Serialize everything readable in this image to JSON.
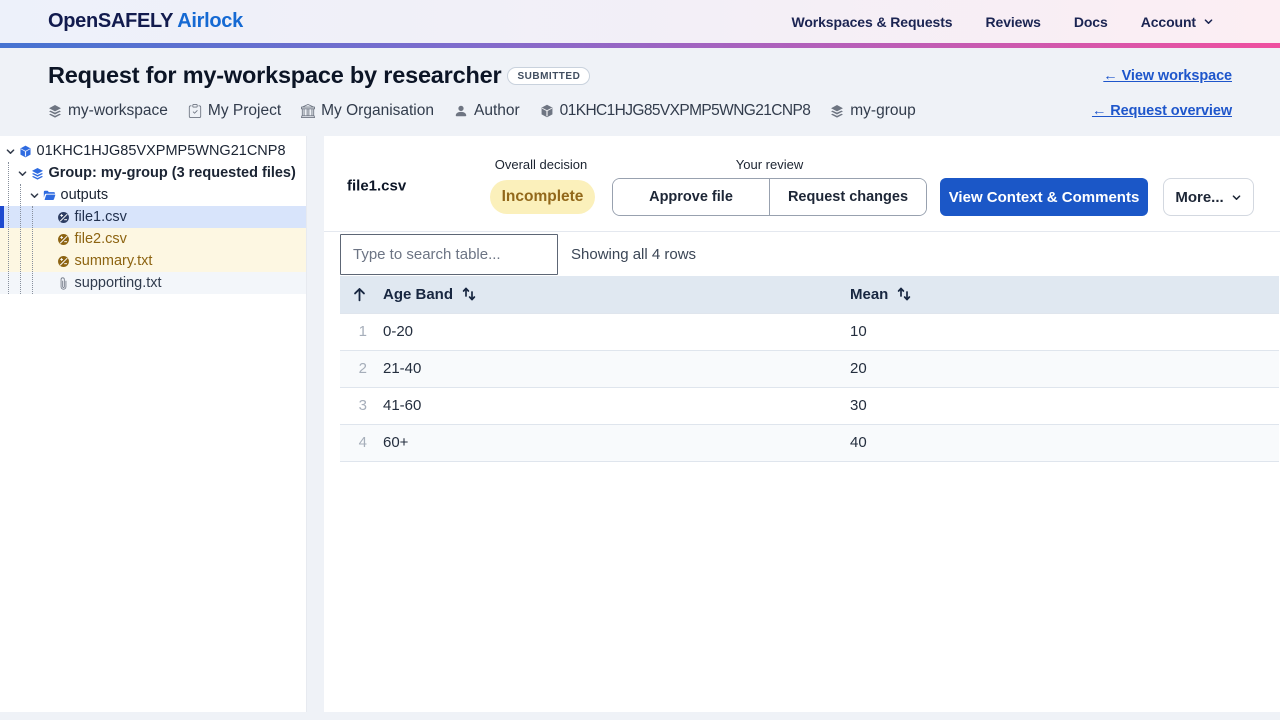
{
  "nav": {
    "brand": {
      "primary": "OpenSAFELY",
      "secondary": "Airlock"
    },
    "links": [
      {
        "label": "Workspaces & Requests",
        "dropdown": false
      },
      {
        "label": "Reviews",
        "dropdown": false
      },
      {
        "label": "Docs",
        "dropdown": false
      },
      {
        "label": "Account",
        "dropdown": true
      }
    ]
  },
  "header": {
    "title": "Request for my-workspace by researcher",
    "status_badge": "SUBMITTED",
    "view_workspace_link": "← View workspace",
    "request_overview_link": "← Request overview",
    "meta": [
      {
        "icon": "layers-icon",
        "label": "my-workspace"
      },
      {
        "icon": "clipboard-icon",
        "label": "My Project"
      },
      {
        "icon": "bank-icon",
        "label": "My Organisation"
      },
      {
        "icon": "person-icon",
        "label": "Author"
      },
      {
        "icon": "cube-icon",
        "label": "01KHC1HJG85VXPMP5WNG21CNP8"
      },
      {
        "icon": "layers-icon",
        "label": "my-group"
      }
    ]
  },
  "sidebar": {
    "tree": [
      {
        "label": "01KHC1HJG85VXPMP5WNG21CNP8",
        "icon": "cube-icon",
        "icon_color": "#2f6be0",
        "level": 0,
        "expanded": true,
        "bold": false,
        "state": "default"
      },
      {
        "label": "Group: my-group (3 requested files)",
        "icon": "layers-icon",
        "icon_color": "#2f6be0",
        "level": 1,
        "expanded": true,
        "bold": true,
        "state": "default"
      },
      {
        "label": "outputs",
        "icon": "folder-icon",
        "icon_color": "#2f6be0",
        "level": 2,
        "expanded": true,
        "bold": false,
        "state": "default"
      },
      {
        "label": "file1.csv",
        "icon": "file-diff-icon",
        "icon_color": "#2d3d63",
        "level": 3,
        "expanded": null,
        "bold": false,
        "state": "selected"
      },
      {
        "label": "file2.csv",
        "icon": "file-diff-icon",
        "icon_color": "#8d6412",
        "level": 3,
        "expanded": null,
        "bold": false,
        "state": "attention"
      },
      {
        "label": "summary.txt",
        "icon": "file-diff-icon",
        "icon_color": "#8d6412",
        "level": 3,
        "expanded": null,
        "bold": false,
        "state": "attention"
      },
      {
        "label": "supporting.txt",
        "icon": "paperclip-icon",
        "icon_color": "#6b7280",
        "level": 3,
        "expanded": null,
        "bold": false,
        "state": "supporting"
      }
    ]
  },
  "content": {
    "file_title": "file1.csv",
    "overall_decision_label": "Overall decision",
    "decision_badge": "Incomplete",
    "your_review_label": "Your review",
    "approve_button": "Approve file",
    "request_changes_button": "Request changes",
    "context_button": "View Context & Comments",
    "more_button": "More...",
    "search_placeholder": "Type to search table...",
    "rows_status": "Showing all 4 rows"
  },
  "table": {
    "columns": [
      {
        "label": "Age Band",
        "sortable": true
      },
      {
        "label": "Mean",
        "sortable": true
      }
    ],
    "rows": [
      {
        "num": "1",
        "age_band": "0-20",
        "mean": "10"
      },
      {
        "num": "2",
        "age_band": "21-40",
        "mean": "20"
      },
      {
        "num": "3",
        "age_band": "41-60",
        "mean": "30"
      },
      {
        "num": "4",
        "age_band": "60+",
        "mean": "40"
      }
    ]
  },
  "colors": {
    "accent_blue": "#1b57c7",
    "selected_row_bg": "#d8e4fb",
    "selected_row_bar": "#1d49cf",
    "attention_row_bg": "#fdf7e2",
    "attention_text": "#8d6412",
    "decision_badge_bg": "#fbf0bb",
    "decision_badge_text": "#92681a",
    "brand_gradient": [
      "#4573d1",
      "#ef4f9f"
    ]
  }
}
